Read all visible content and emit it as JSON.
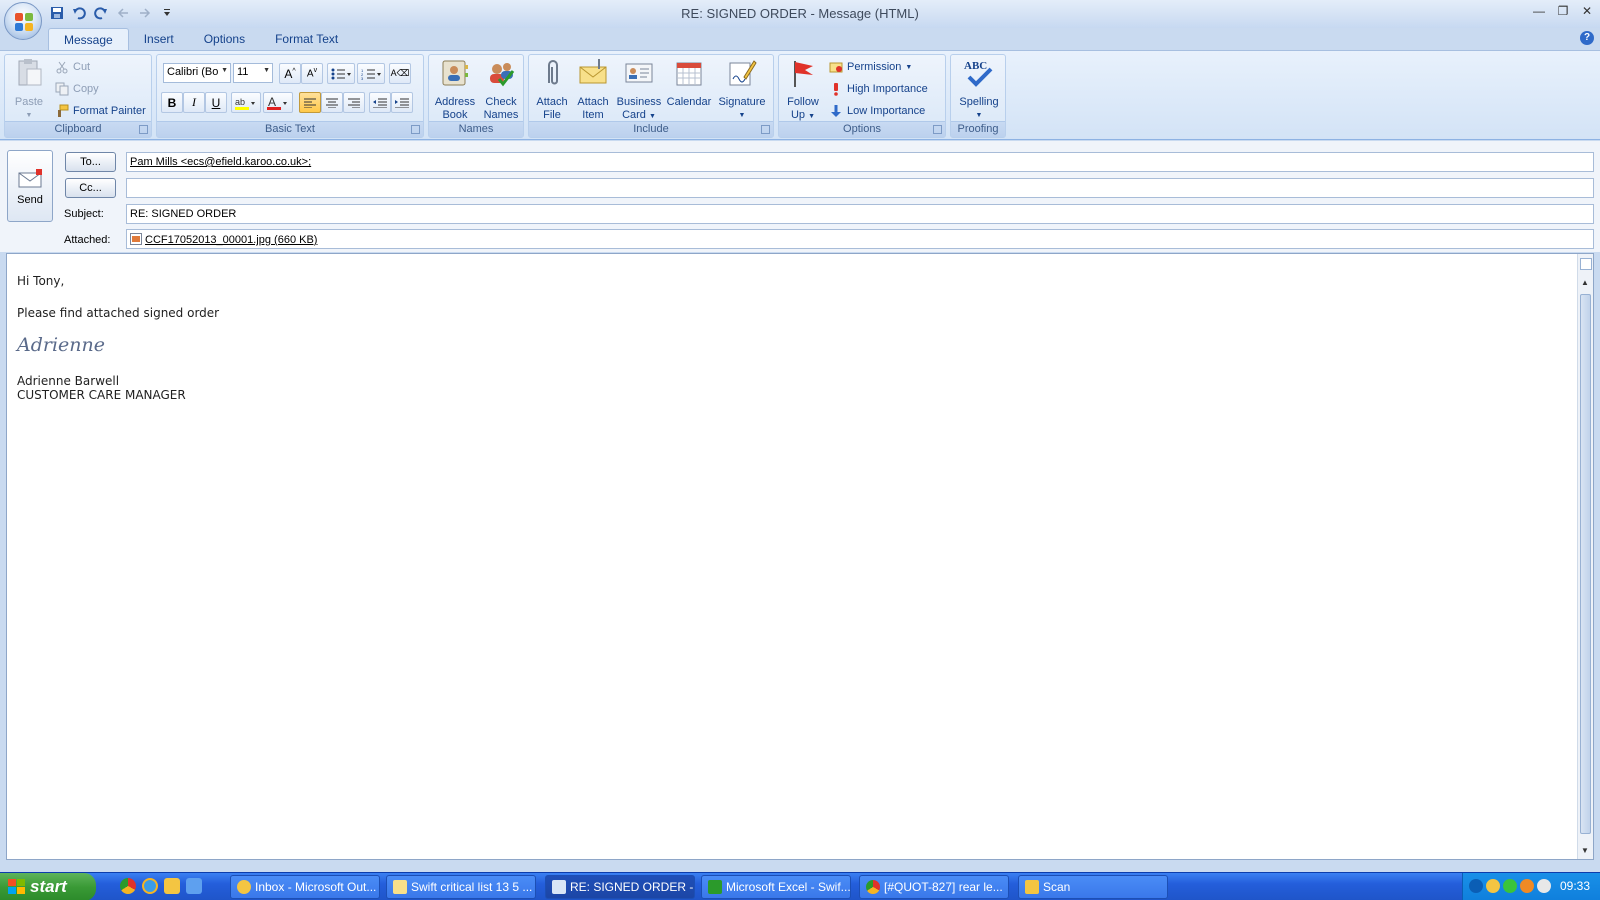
{
  "window": {
    "title": "RE: SIGNED ORDER - Message (HTML)"
  },
  "ribbon_tabs": [
    "Message",
    "Insert",
    "Options",
    "Format Text"
  ],
  "clipboard": {
    "paste": "Paste",
    "cut": "Cut",
    "copy": "Copy",
    "format_painter": "Format Painter",
    "label": "Clipboard"
  },
  "basic_text": {
    "font_name": "Calibri (Bo",
    "font_size": "11",
    "bold": "B",
    "italic": "I",
    "underline": "U",
    "label": "Basic Text"
  },
  "names": {
    "address_book_1": "Address",
    "address_book_2": "Book",
    "check_names_1": "Check",
    "check_names_2": "Names",
    "label": "Names"
  },
  "include": {
    "attach_file_1": "Attach",
    "attach_file_2": "File",
    "attach_item_1": "Attach",
    "attach_item_2": "Item",
    "business_card_1": "Business",
    "business_card_2": "Card",
    "calendar": "Calendar",
    "signature": "Signature",
    "label": "Include"
  },
  "options": {
    "follow_up_1": "Follow",
    "follow_up_2": "Up",
    "permission": "Permission",
    "high_importance": "High Importance",
    "low_importance": "Low Importance",
    "label": "Options"
  },
  "proofing": {
    "abc": "ABC",
    "spelling": "Spelling",
    "label": "Proofing"
  },
  "header": {
    "send": "Send",
    "to_button": "To...",
    "cc_button": "Cc...",
    "to_value": "Pam Mills <ecs@efield.karoo.co.uk>;",
    "cc_value": "",
    "subject_label": "Subject:",
    "subject_value": "RE: SIGNED ORDER",
    "attached_label": "Attached:",
    "attachment": "CCF17052013_00001.jpg (660 KB)"
  },
  "body": {
    "greeting": "Hi Tony,",
    "line1": "Please find  attached signed order",
    "signature_script": "Adrienne",
    "sig_name": "Adrienne Barwell",
    "sig_title": "CUSTOMER CARE MANAGER"
  },
  "taskbar": {
    "start": "start",
    "tasks": [
      "Inbox - Microsoft Out...",
      "Swift critical list 13 5 ...",
      "RE: SIGNED ORDER -...",
      "Microsoft Excel - Swif...",
      "[#QUOT-827] rear le...",
      "Scan"
    ],
    "clock": "09:33"
  },
  "colors": {
    "ribbon_text": "#15428b",
    "taskbar_blue": "#245edb",
    "start_green": "#3a9a36"
  }
}
